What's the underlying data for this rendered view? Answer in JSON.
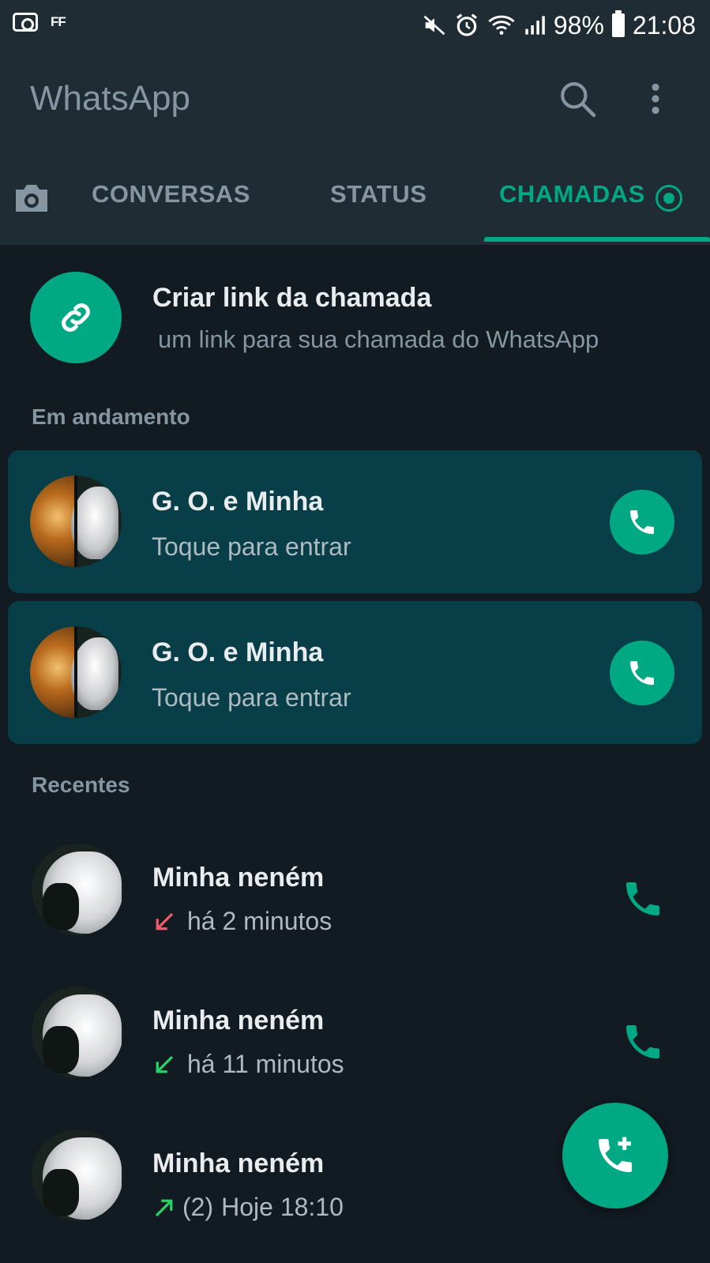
{
  "status_bar": {
    "left_badge": "FF",
    "battery": "98%",
    "time": "21:08"
  },
  "app_bar": {
    "title": "WhatsApp",
    "search_icon": "search-icon",
    "more_icon": "more-vert-icon"
  },
  "tabs": {
    "camera_icon": "camera-icon",
    "items": [
      {
        "label": "CONVERSAS",
        "selected": false
      },
      {
        "label": "STATUS",
        "selected": false
      },
      {
        "label": "CHAMADAS",
        "selected": true
      }
    ]
  },
  "create_link": {
    "title": "Criar link da chamada",
    "subtitle": " um link para sua chamada do WhatsApp",
    "icon": "link-icon"
  },
  "ongoing": {
    "label": "Em andamento",
    "calls": [
      {
        "name": "G. O. e Minha",
        "subtitle": "Toque para entrar"
      },
      {
        "name": "G. O. e Minha",
        "subtitle": "Toque para entrar"
      }
    ]
  },
  "recent": {
    "label": "Recentes",
    "calls": [
      {
        "name": "Minha neném",
        "direction": "missed-incoming",
        "count": "",
        "time": "há 2 minutos",
        "arrow_color": "#f15c6d"
      },
      {
        "name": "Minha neném",
        "direction": "incoming",
        "count": "",
        "time": "há 11 minutos",
        "arrow_color": "#25d366"
      },
      {
        "name": "Minha neném",
        "direction": "outgoing",
        "count": "(2)",
        "time": "Hoje 18:10",
        "arrow_color": "#25d366"
      }
    ]
  },
  "fab": {
    "icon": "add-call-icon"
  },
  "colors": {
    "accent": "#00a884",
    "background": "#121b22",
    "header": "#1f2c34",
    "ongoing_card": "#073e48",
    "missed": "#f15c6d"
  }
}
